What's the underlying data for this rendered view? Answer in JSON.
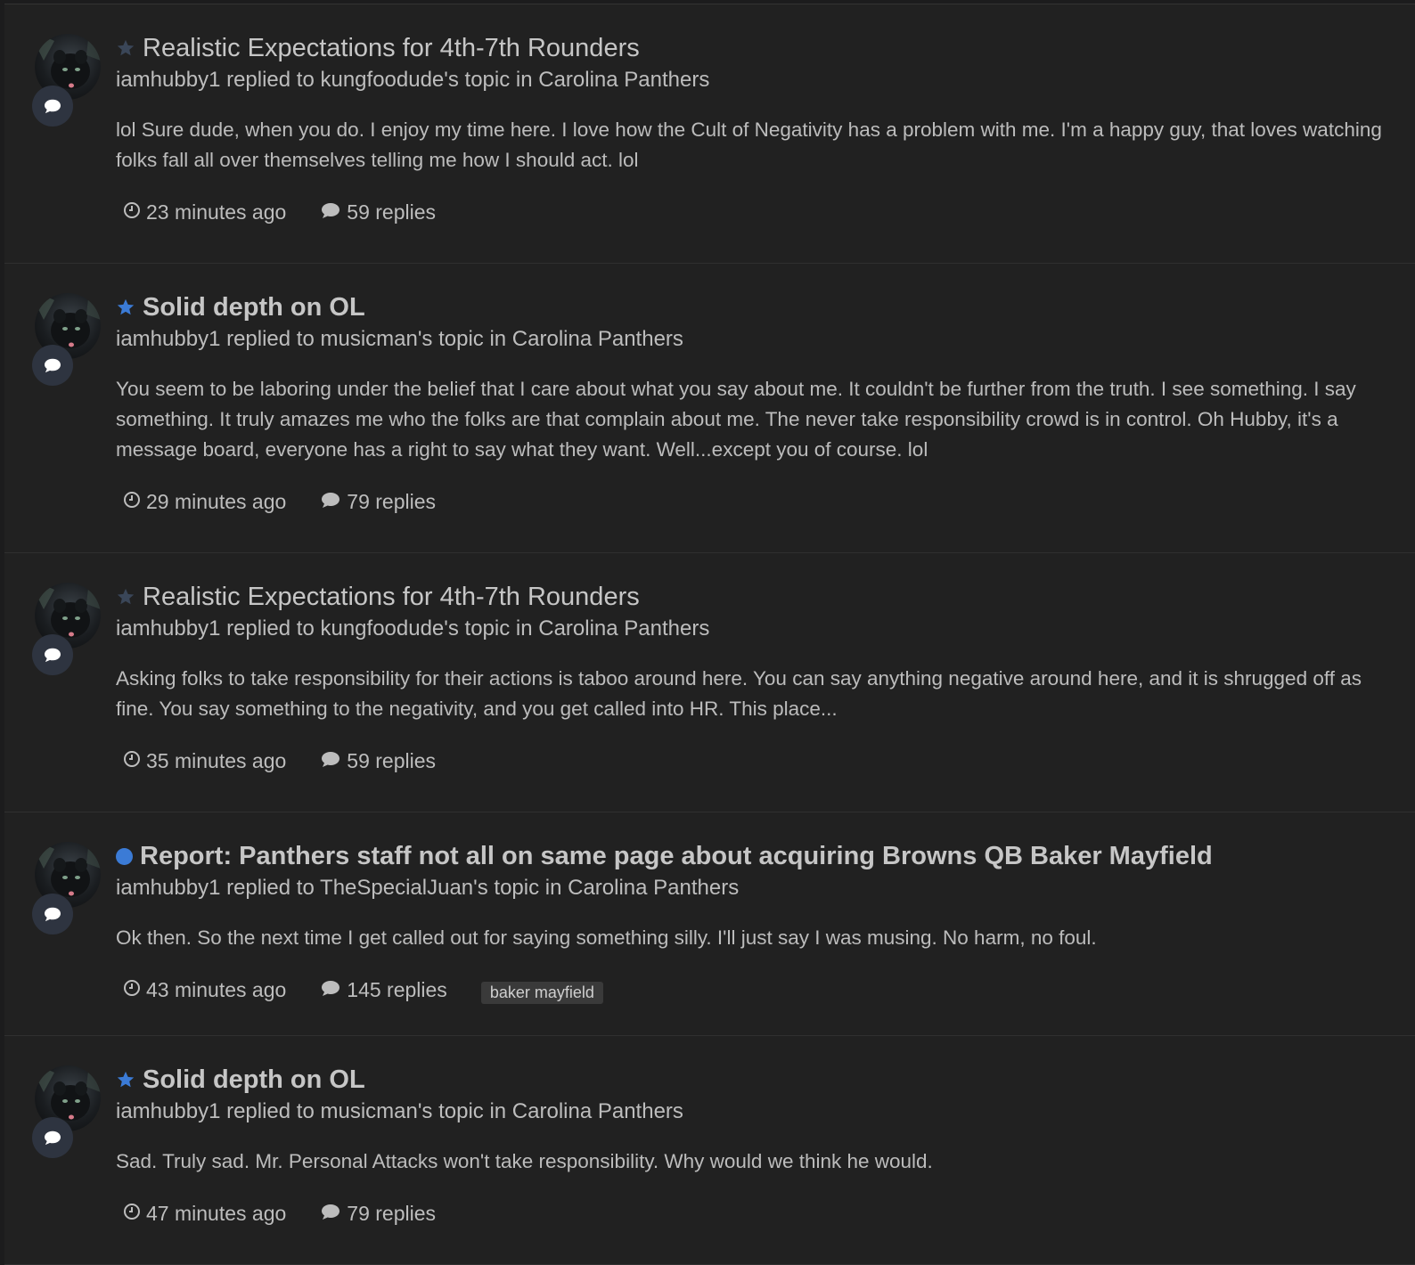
{
  "colors": {
    "background": "#1c1c1d",
    "panel": "#212121",
    "accent_blue": "#3b7bd6",
    "star_inactive": "#3a4658",
    "text": "#c6c6c6"
  },
  "items": [
    {
      "indicator": "star-outline-icon",
      "title": "Realistic Expectations for 4th-7th Rounders",
      "unread": false,
      "meta": "iamhubby1 replied to kungfoodude's topic in Carolina Panthers",
      "snippet": "lol Sure dude, when you do. I enjoy my time here. I love how the Cult of Negativity has a problem with me. I'm a happy guy, that loves watching folks fall all over themselves telling me how I should act. lol",
      "time": "23 minutes ago",
      "replies": "59 replies",
      "tag": ""
    },
    {
      "indicator": "star-icon",
      "title": "Solid depth on OL",
      "unread": true,
      "meta": "iamhubby1 replied to musicman's topic in Carolina Panthers",
      "snippet": "You seem to be laboring under the belief that I care about what you say about me. It couldn't be further from the truth. I see something. I say something. It truly amazes me who the folks are that complain about me. The never take responsibility crowd is in control. Oh Hubby, it's a message board, everyone has a right to say what they want. Well...except you of course. lol",
      "time": "29 minutes ago",
      "replies": "79 replies",
      "tag": ""
    },
    {
      "indicator": "star-outline-icon",
      "title": "Realistic Expectations for 4th-7th Rounders",
      "unread": false,
      "meta": "iamhubby1 replied to kungfoodude's topic in Carolina Panthers",
      "snippet": "Asking folks to take responsibility for their actions is taboo around here. You can say anything negative around here, and it is shrugged off as fine. You say something to the negativity, and you get called into HR. This place...",
      "time": "35 minutes ago",
      "replies": "59 replies",
      "tag": ""
    },
    {
      "indicator": "unread-dot-icon",
      "title": "Report: Panthers staff not all on same page about acquiring Browns QB Baker Mayfield",
      "unread": true,
      "meta": "iamhubby1 replied to TheSpecialJuan's topic in Carolina Panthers",
      "snippet": "Ok then. So the next time I get called out for saying something silly. I'll just say I was musing. No harm, no foul.",
      "time": "43 minutes ago",
      "replies": "145 replies",
      "tag": "baker mayfield"
    },
    {
      "indicator": "star-icon",
      "title": "Solid depth on OL",
      "unread": true,
      "meta": "iamhubby1 replied to musicman's topic in Carolina Panthers",
      "snippet": "Sad. Truly sad. Mr. Personal Attacks won't take responsibility. Why would we think he would.",
      "time": "47 minutes ago",
      "replies": "79 replies",
      "tag": ""
    }
  ]
}
